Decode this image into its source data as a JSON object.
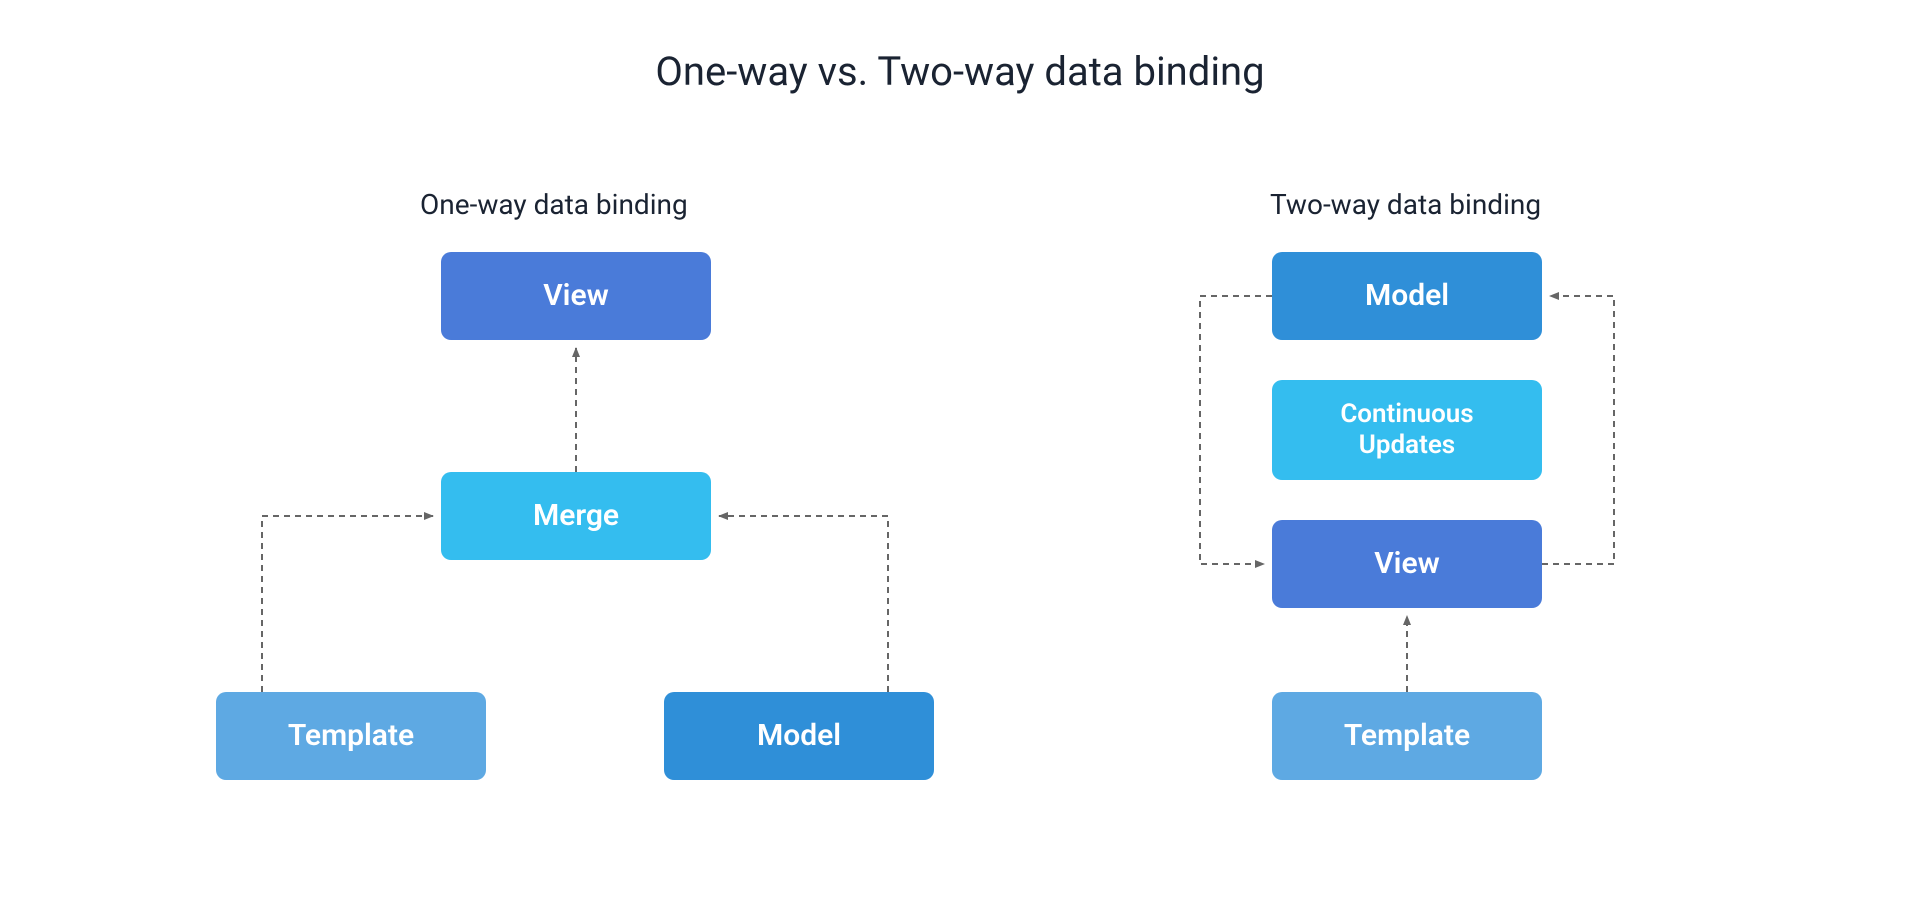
{
  "title": "One-way vs. Two-way data binding",
  "left": {
    "subtitle": "One-way data binding",
    "view": "View",
    "merge": "Merge",
    "template": "Template",
    "model": "Model"
  },
  "right": {
    "subtitle": "Two-way data binding",
    "model": "Model",
    "continuous": "Continuous\nUpdates",
    "view": "View",
    "template": "Template"
  }
}
